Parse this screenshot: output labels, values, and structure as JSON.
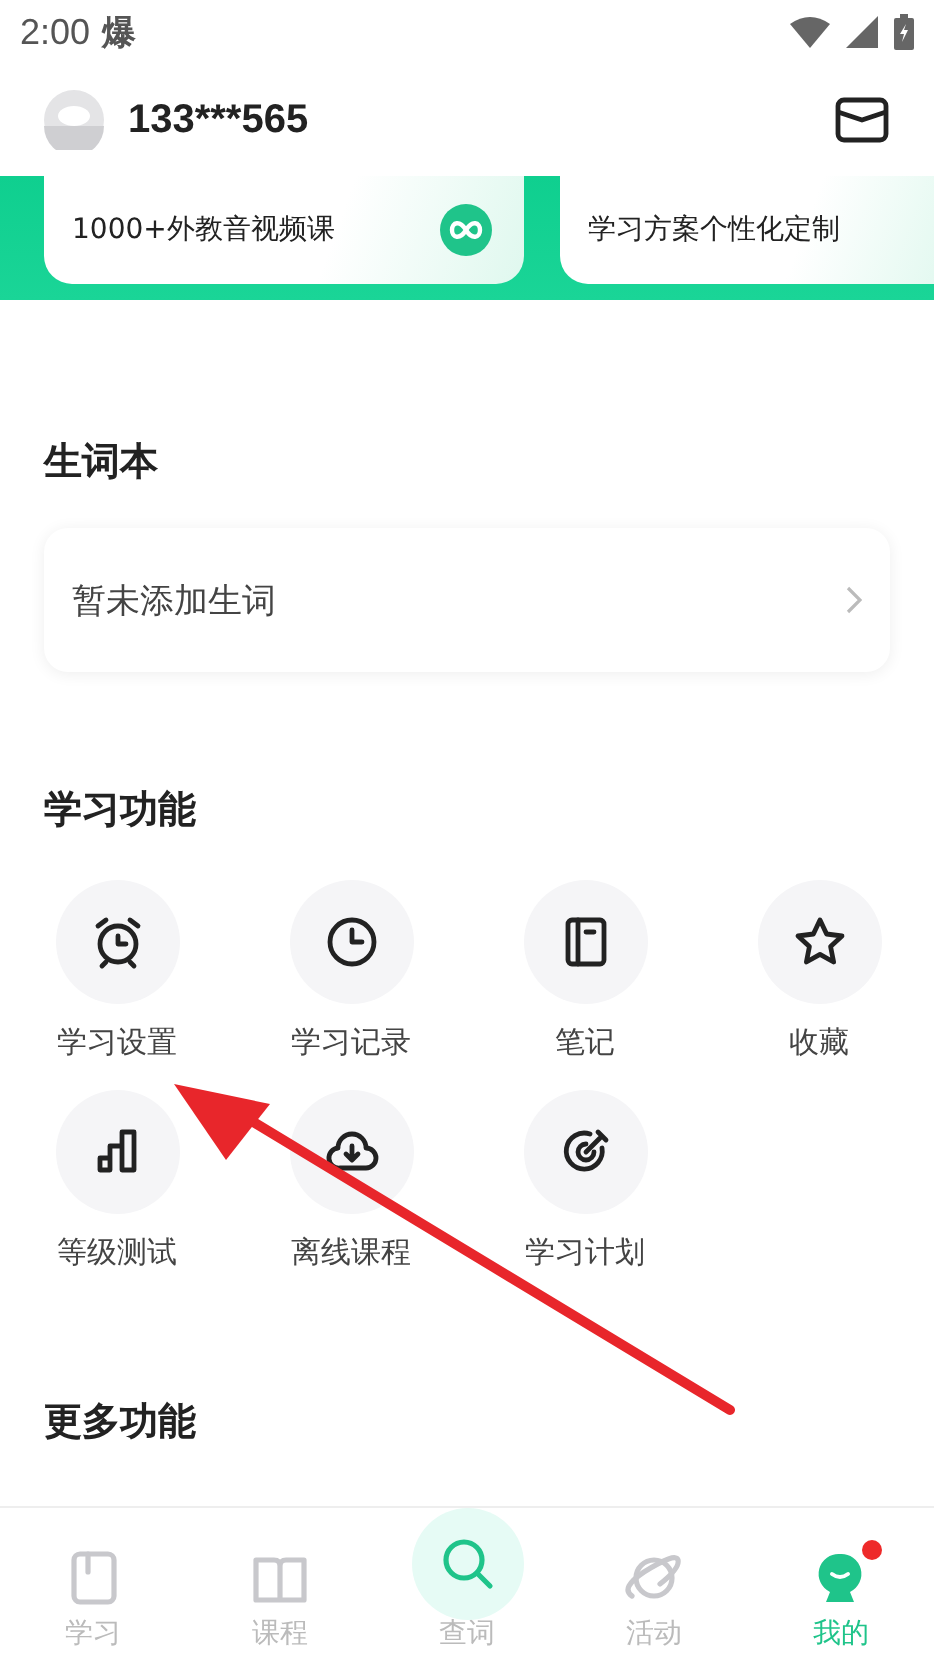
{
  "status_bar": {
    "time": "2:00",
    "app_glyph": "爆"
  },
  "header": {
    "username": "133***565"
  },
  "banner_cards": [
    {
      "subtitle": "1000+外教音视频课",
      "kind": "video"
    },
    {
      "subtitle": "学习方案个性化定制",
      "kind": "plan"
    }
  ],
  "vocabulary": {
    "title": "生词本",
    "empty_text": "暂未添加生词"
  },
  "study_features": {
    "title": "学习功能",
    "items": [
      {
        "label": "学习设置",
        "kind": "alarm"
      },
      {
        "label": "学习记录",
        "kind": "clock"
      },
      {
        "label": "笔记",
        "kind": "notebook"
      },
      {
        "label": "收藏",
        "kind": "star"
      },
      {
        "label": "等级测试",
        "kind": "chart"
      },
      {
        "label": "离线课程",
        "kind": "download"
      },
      {
        "label": "学习计划",
        "kind": "target"
      }
    ]
  },
  "more_features": {
    "title": "更多功能"
  },
  "tab_bar": [
    {
      "label": "学习",
      "kind": "book",
      "selected": false,
      "dot": false
    },
    {
      "label": "课程",
      "kind": "open-book",
      "selected": false,
      "dot": false
    },
    {
      "label": "查词",
      "kind": "search",
      "selected": false,
      "dot": false
    },
    {
      "label": "活动",
      "kind": "planet",
      "selected": false,
      "dot": false
    },
    {
      "label": "我的",
      "kind": "mascot",
      "selected": true,
      "dot": true
    }
  ]
}
